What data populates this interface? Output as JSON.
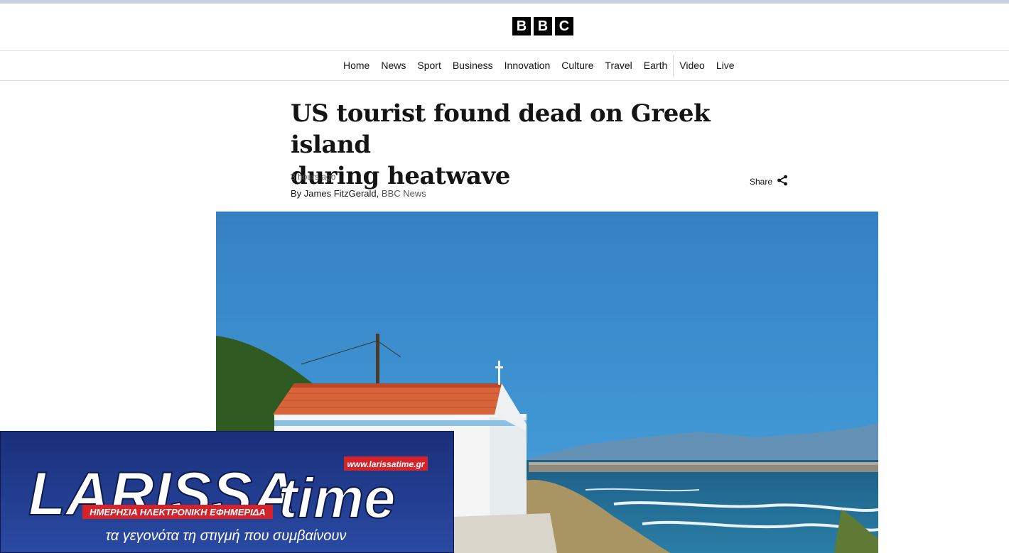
{
  "brand": {
    "letters": [
      "B",
      "B",
      "C"
    ]
  },
  "nav": {
    "items": [
      "Home",
      "News",
      "Sport",
      "Business",
      "Innovation",
      "Culture",
      "Travel",
      "Earth",
      "Video",
      "Live"
    ]
  },
  "article": {
    "headline_line1": "US tourist found dead on Greek island",
    "headline_line2": "during heatwave",
    "timestamp": "3 hours ago",
    "byline_prefix": "By ",
    "author": "James FitzGerald",
    "byline_sep": ",",
    "organisation": " BBC News",
    "share_label": "Share"
  },
  "hero_image": {
    "description_icon": "photo-chapel-by-sea"
  },
  "watermark_banner": {
    "logo_text_main": "LARISSA",
    "logo_text_accent": "time",
    "logo_letter": "t",
    "url": "www.larissatime.gr",
    "subtitle": "ΗΜΕΡΗΣΙΑ ΗΛΕΚΤΡΟΝΙΚΗ ΕΦΗΜΕΡΙΔΑ",
    "tagline": "τα γεγονότα τη στιγμή που συμβαίνουν"
  },
  "colors": {
    "sky_top": "#3b84c4",
    "sky_bottom": "#3f9bd6",
    "roof": "#d9643a",
    "banner_bg": "#1f3a8f",
    "banner_red": "#d4232a"
  }
}
